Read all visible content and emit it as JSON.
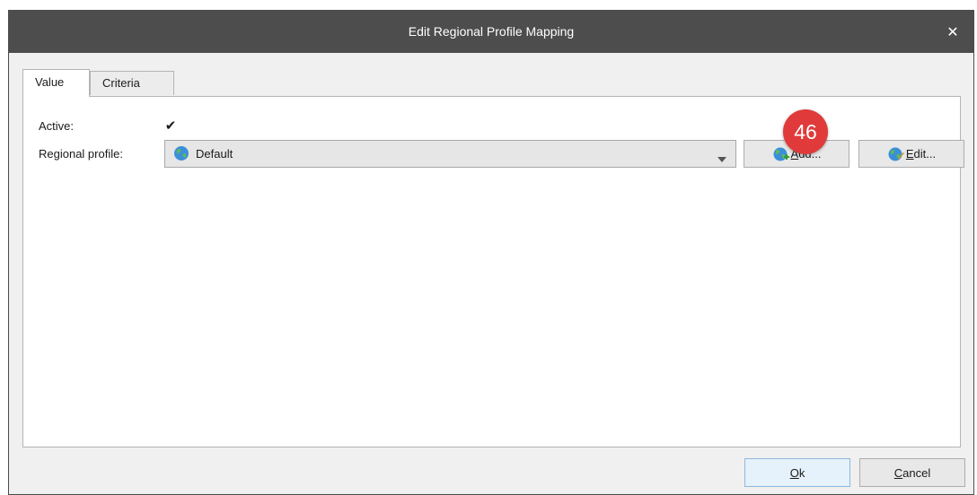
{
  "window": {
    "title": "Edit Regional Profile Mapping",
    "close_glyph": "✕"
  },
  "tabs": [
    {
      "label": "Value",
      "active": true
    },
    {
      "label": "Criteria",
      "active": false
    }
  ],
  "form": {
    "active_label": "Active:",
    "active_checked": true,
    "check_glyph": "✔",
    "regional_profile_label": "Regional profile:",
    "regional_profile_value": "Default",
    "add_button": {
      "mnemonic": "A",
      "rest": "dd...",
      "icon": "globe-add-icon"
    },
    "edit_button": {
      "mnemonic": "E",
      "rest": "dit...",
      "icon": "globe-edit-icon"
    }
  },
  "badge": {
    "number": "46",
    "color": "#e03a3a"
  },
  "footer": {
    "ok": {
      "mnemonic": "O",
      "rest": "k"
    },
    "cancel": {
      "mnemonic": "C",
      "rest": "ancel"
    }
  },
  "colors": {
    "titlebar": "#4d4d4d",
    "accent": "#e03a3a"
  }
}
